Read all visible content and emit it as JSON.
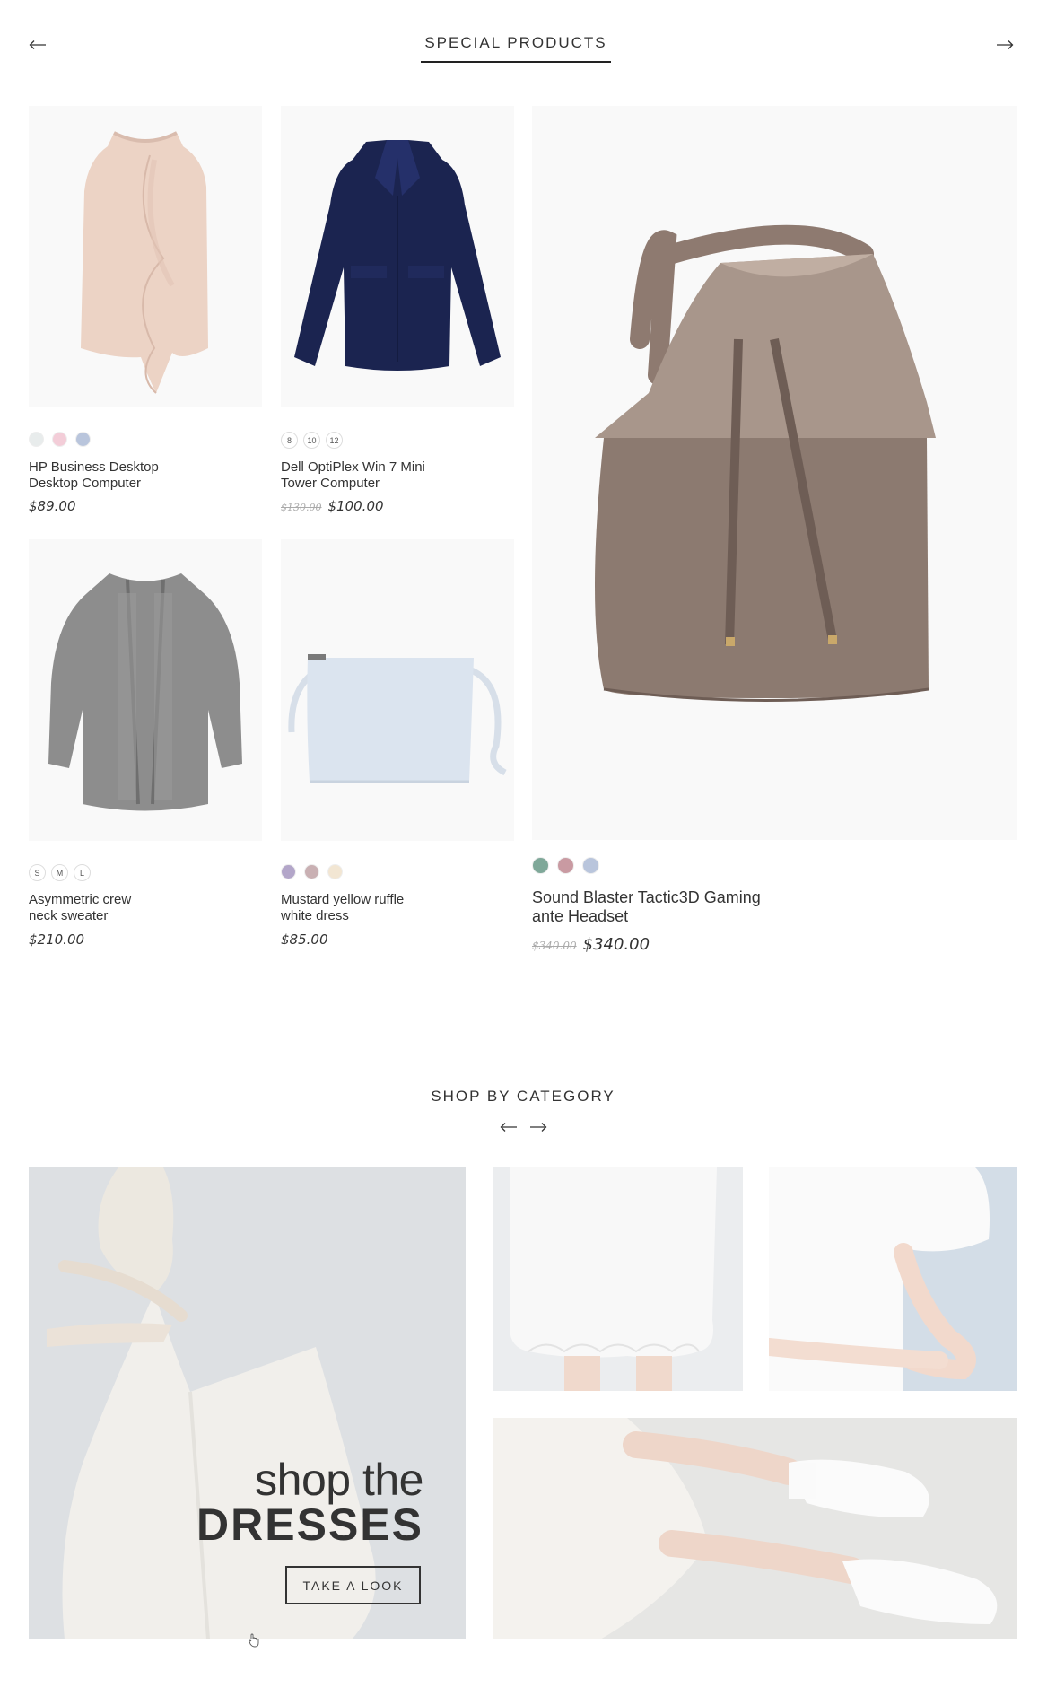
{
  "special": {
    "title": "SPECIAL PRODUCTS"
  },
  "products": [
    {
      "name_line1": "HP Business Desktop",
      "name_line2": "Desktop Computer",
      "price": "$89.00",
      "old_price": "",
      "swatches": [
        "#e8ecec",
        "#f3cdd8",
        "#b9c5dc"
      ]
    },
    {
      "name_line1": "Dell OptiPlex Win 7 Mini",
      "name_line2": "Tower Computer",
      "price": "$100.00",
      "old_price": "$130.00",
      "sizes": [
        "8",
        "10",
        "12"
      ]
    },
    {
      "name_line1": "Sound Blaster Tactic3D Gaming",
      "name_line2": "ante Headset",
      "price": "$340.00",
      "old_price": "$340.00",
      "swatches": [
        "#7fa899",
        "#c99aa2",
        "#b9c5dc"
      ]
    },
    {
      "name_line1": "Asymmetric crew",
      "name_line2": "neck sweater",
      "price": "$210.00",
      "old_price": "",
      "sizes": [
        "S",
        "M",
        "L"
      ]
    },
    {
      "name_line1": "Mustard yellow ruffle",
      "name_line2": "white dress",
      "price": "$85.00",
      "old_price": "",
      "swatches": [
        "#b3a6c9",
        "#c9b0b3",
        "#f2e6d3"
      ]
    }
  ],
  "category": {
    "title": "SHOP BY CATEGORY",
    "banner_line1": "shop the",
    "banner_line2": "DRESSES",
    "cta": "TAKE A LOOK"
  },
  "icons": {
    "prev": "arrow-left-icon",
    "next": "arrow-right-icon"
  }
}
